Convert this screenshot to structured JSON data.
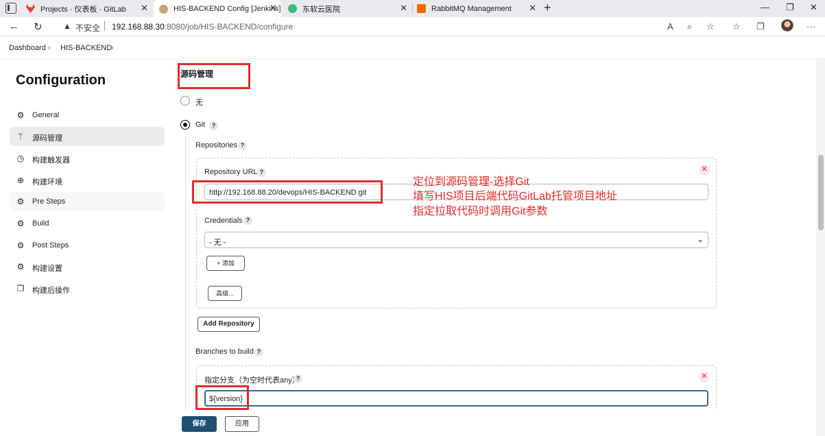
{
  "browser": {
    "tabs": [
      {
        "label": "Projects · 仪表板 · GitLab",
        "favicon_color": "#e2432a"
      },
      {
        "label": "HIS-BACKEND Config [Jenkins]",
        "favicon_color": "#c9a37b"
      },
      {
        "label": "东软云医院",
        "favicon_color": "#41b883"
      },
      {
        "label": "RabbitMQ Management",
        "favicon_color": "#ff6600"
      }
    ],
    "insecure_label": "不安全",
    "url_host": "192.168.88.30",
    "url_rest": ":8080/job/HIS-BACKEND/configure"
  },
  "breadcrumb": {
    "items": [
      "Dashboard",
      "HIS-BACKEND"
    ]
  },
  "sidebar": {
    "title": "Configuration",
    "items": [
      {
        "label": "General",
        "icon": "gear-icon"
      },
      {
        "label": "源码管理",
        "icon": "git-branch-icon"
      },
      {
        "label": "构建触发器",
        "icon": "clock-icon"
      },
      {
        "label": "构建环境",
        "icon": "globe-icon"
      },
      {
        "label": "Pre Steps",
        "icon": "gear-icon"
      },
      {
        "label": "Build",
        "icon": "gear-icon"
      },
      {
        "label": "Post Steps",
        "icon": "gear-icon"
      },
      {
        "label": "构建设置",
        "icon": "gear-icon"
      },
      {
        "label": "构建后操作",
        "icon": "cube-icon"
      }
    ]
  },
  "scm": {
    "section_title": "源码管理",
    "option_none": "无",
    "option_git": "Git",
    "repositories_label": "Repositories",
    "repo_url_label": "Repository URL",
    "repo_url_value": "http://192.168.88.20/devops/HIS-BACKEND.git",
    "credentials_label": "Credentials",
    "credentials_value": "- 无 -",
    "add_button": "添加",
    "advanced_button": "高级...",
    "add_repository_button": "Add Repository",
    "branches_label": "Branches to build",
    "branch_specifier_label": "指定分支（为空时代表any）",
    "branch_value": "${version}"
  },
  "footer": {
    "save": "保存",
    "apply": "应用"
  },
  "annotation": {
    "lines": [
      "定位到源码管理-选择Git",
      "填写HIS项目后端代码GitLab托管项目地址",
      "指定拉取代码时调用Git参数"
    ],
    "color": "#e32b2b"
  }
}
